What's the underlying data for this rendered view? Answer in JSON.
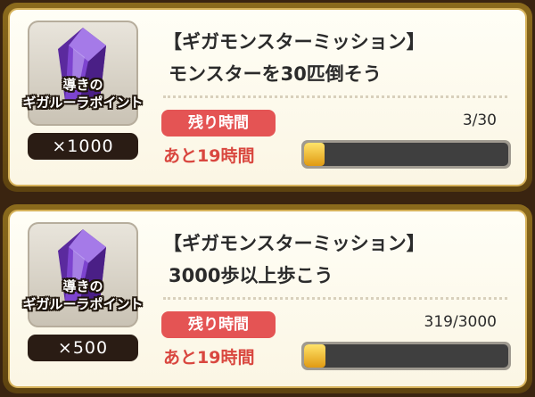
{
  "missions": [
    {
      "title": "【ギガモンスターミッション】",
      "description": "モンスターを30匹倒そう",
      "reward": {
        "name_line1": "導きの",
        "name_line2": "ギガルーラポイント",
        "quantity": "×1000",
        "icon": "purple-crystal-icon"
      },
      "time_badge": "残り時間",
      "time_left": "あと19時間",
      "progress_text": "3/30",
      "progress_fraction": 0.1
    },
    {
      "title": "【ギガモンスターミッション】",
      "description": "3000歩以上歩こう",
      "reward": {
        "name_line1": "導きの",
        "name_line2": "ギガルーラポイント",
        "quantity": "×500",
        "icon": "purple-crystal-icon"
      },
      "time_badge": "残り時間",
      "time_left": "あと19時間",
      "progress_text": "319/3000",
      "progress_fraction": 0.1063
    }
  ],
  "colors": {
    "frame": "#7a5a17",
    "badge": "#e45454",
    "time_text": "#d9473f",
    "progress_fill": "#f1b730"
  }
}
